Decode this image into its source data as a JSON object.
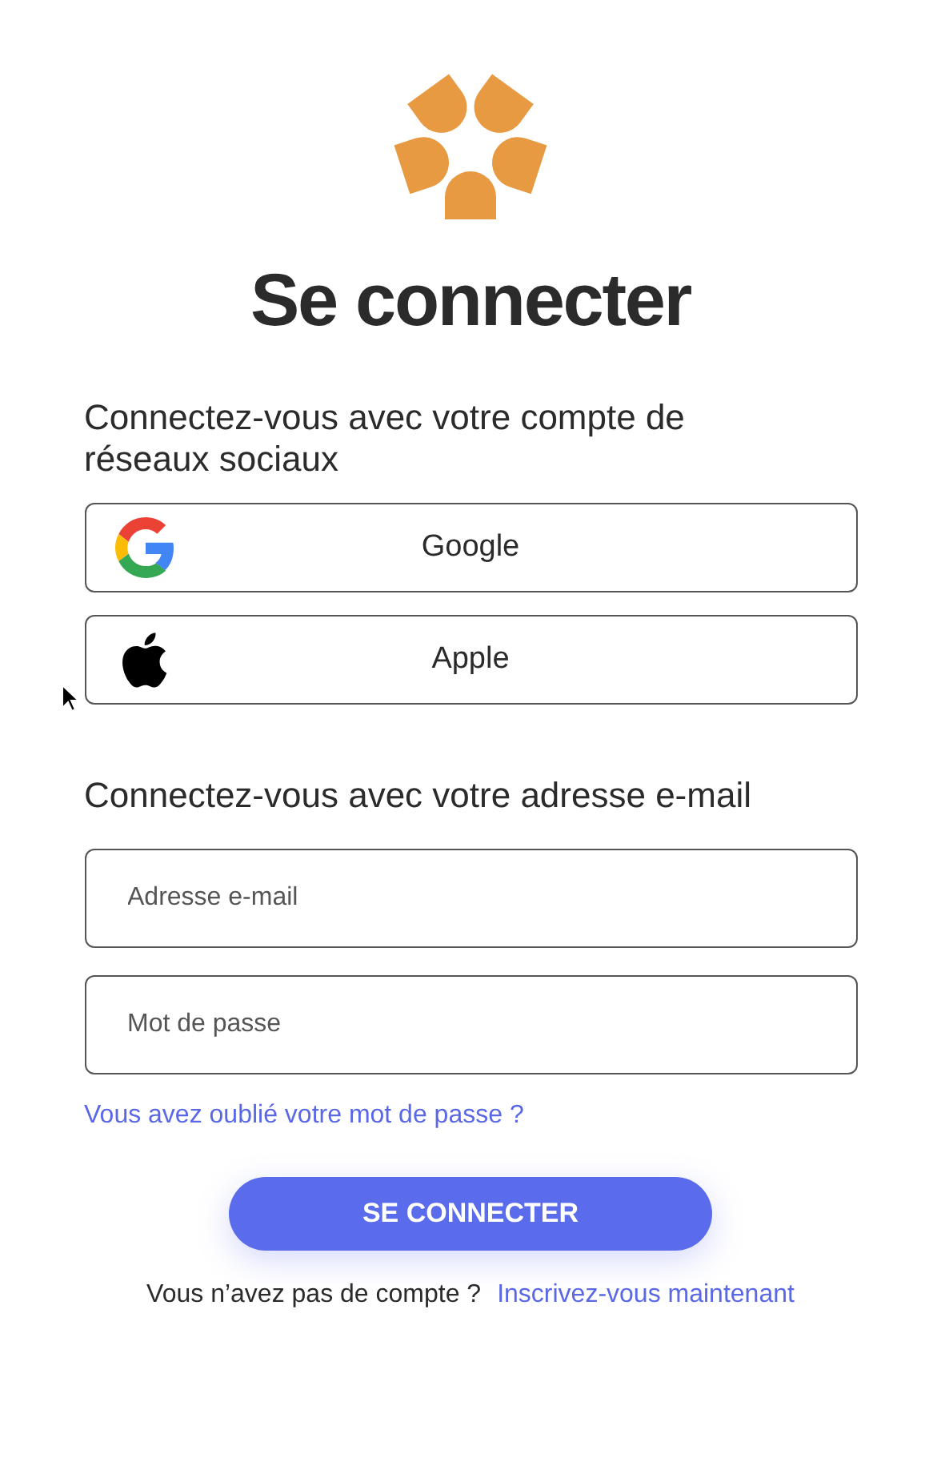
{
  "title": "Se connecter",
  "social_heading": "Connectez-vous avec votre compte de réseaux sociaux",
  "social_buttons": [
    {
      "kind": "google",
      "label": "Google"
    },
    {
      "kind": "apple",
      "label": "Apple"
    }
  ],
  "email_heading": "Connectez-vous avec votre adresse e-mail",
  "fields": [
    {
      "placeholder": "Adresse e-mail"
    },
    {
      "placeholder": "Mot de passe"
    }
  ],
  "forgot_link": "Vous avez oublié votre mot de passe ?",
  "submit_button": "SE CONNECTER",
  "signup_prompt": "Vous n’avez pas de compte ?",
  "signup_link": "Inscrivez-vous maintenant"
}
